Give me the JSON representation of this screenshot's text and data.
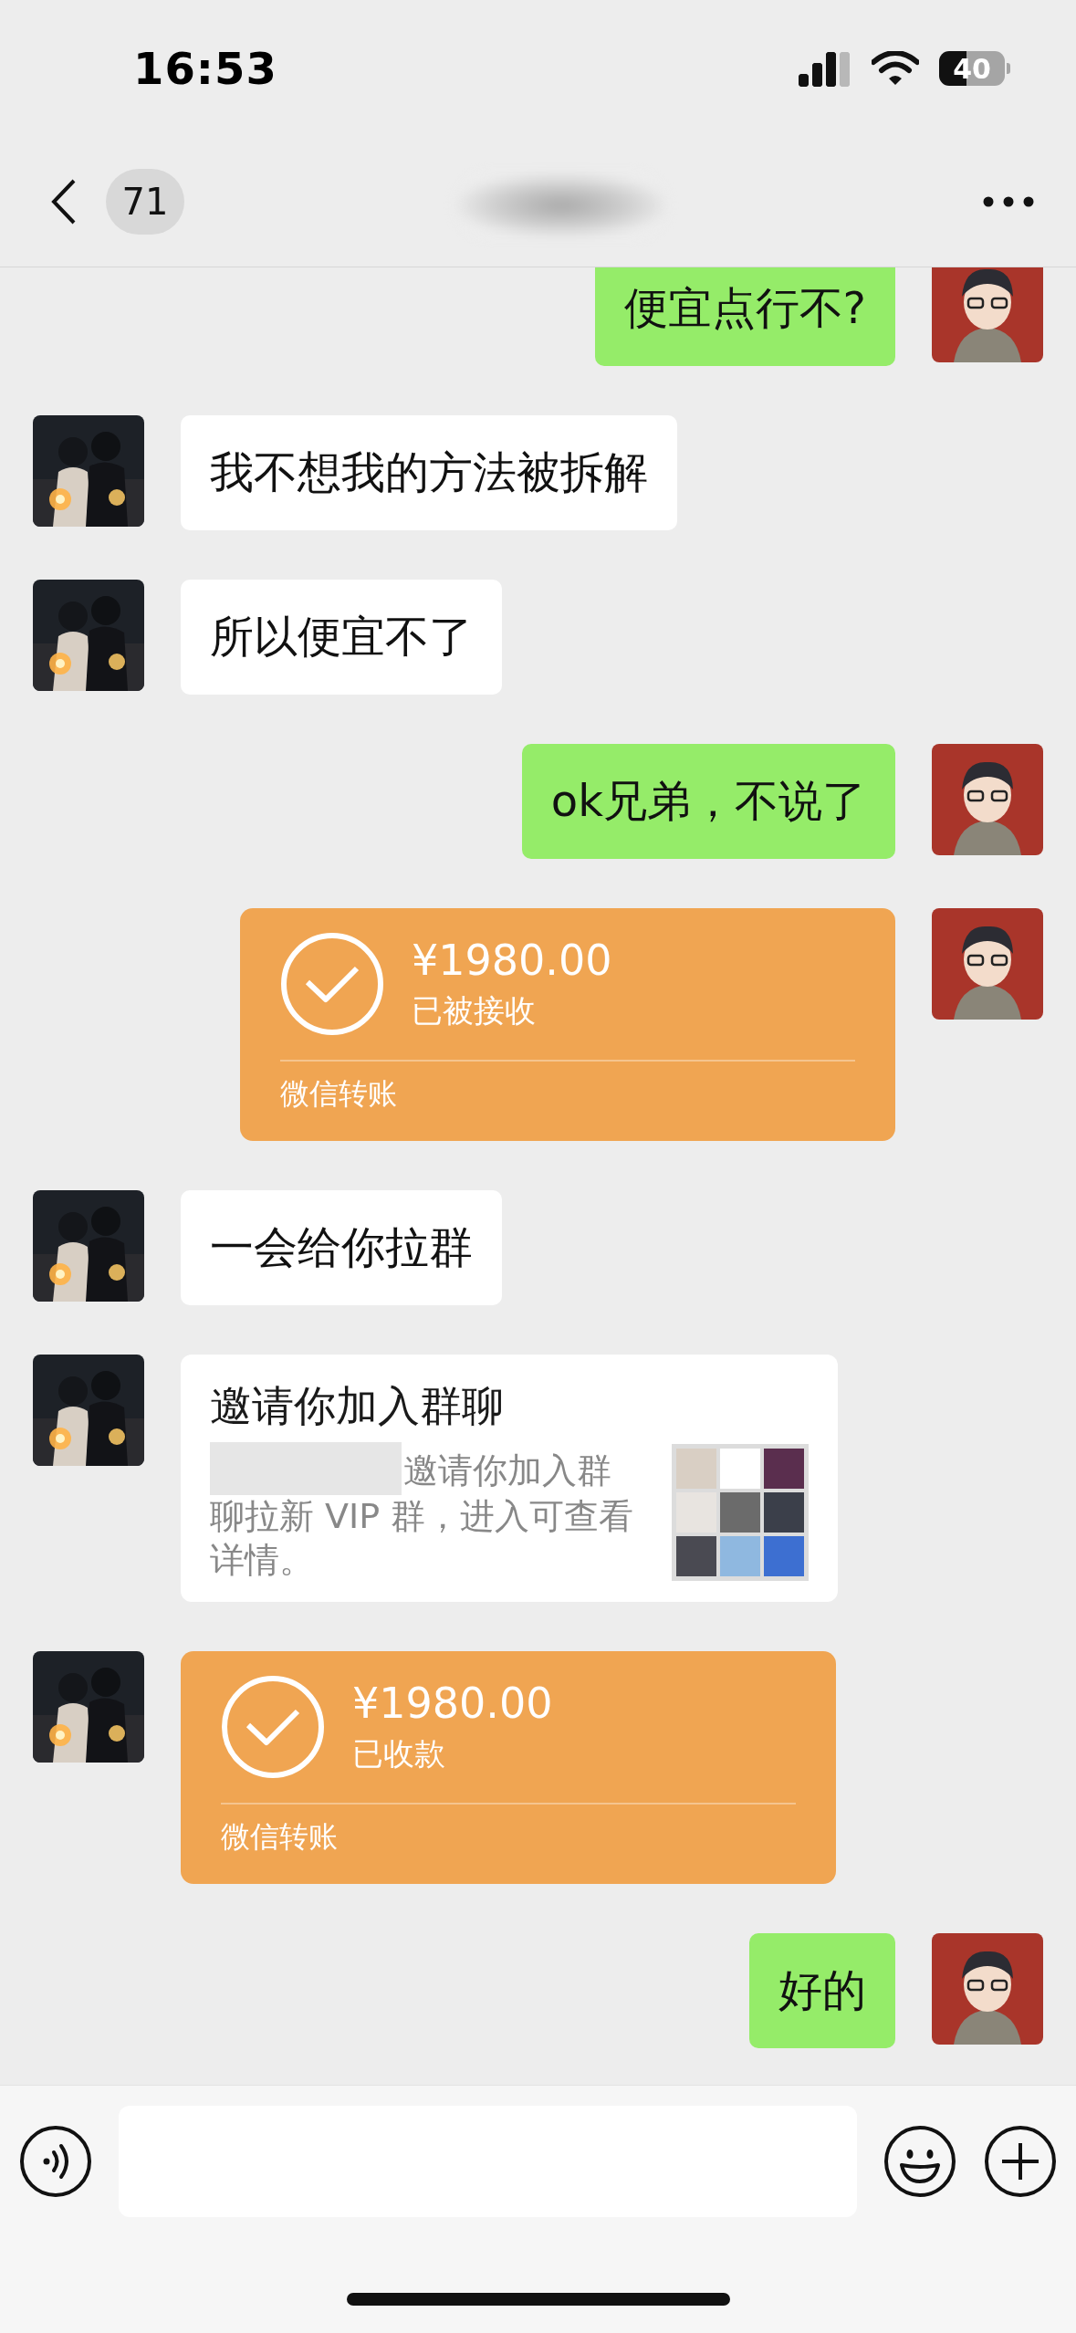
{
  "status_bar": {
    "time": "16:53",
    "battery": "40"
  },
  "nav": {
    "unread_count": "71"
  },
  "messages": [
    {
      "kind": "text",
      "outgoing": true,
      "text": "便宜点行不?"
    },
    {
      "kind": "text",
      "outgoing": false,
      "text": "我不想我的方法被拆解"
    },
    {
      "kind": "text",
      "outgoing": false,
      "text": "所以便宜不了"
    },
    {
      "kind": "text",
      "outgoing": true,
      "text": "ok兄弟，不说了"
    },
    {
      "kind": "transfer",
      "outgoing": true,
      "amount": "¥1980.00",
      "status": "已被接收",
      "label": "微信转账"
    },
    {
      "kind": "text",
      "outgoing": false,
      "text": "一会给你拉群"
    },
    {
      "kind": "invite",
      "outgoing": false,
      "title": "邀请你加入群聊",
      "description": "邀请你加入群聊拉新 VIP 群，进入可查看详情。"
    },
    {
      "kind": "transfer",
      "outgoing": false,
      "amount": "¥1980.00",
      "status": "已收款",
      "label": "微信转账"
    },
    {
      "kind": "text",
      "outgoing": true,
      "text": "好的"
    }
  ]
}
